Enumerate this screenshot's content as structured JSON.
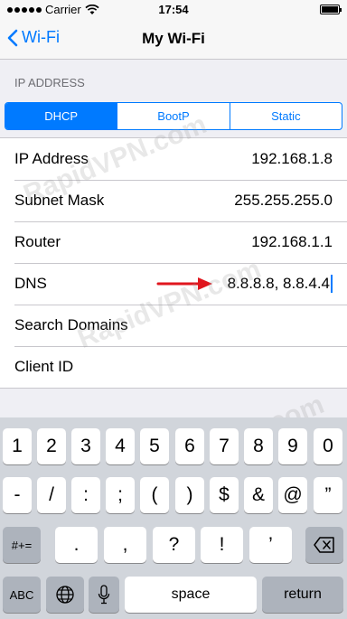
{
  "status_bar": {
    "carrier": "Carrier",
    "time": "17:54",
    "battery_level": 1.0
  },
  "nav": {
    "back_label": "Wi-Fi",
    "title": "My Wi-Fi"
  },
  "section_header": "IP ADDRESS",
  "segments": [
    {
      "label": "DHCP",
      "selected": true
    },
    {
      "label": "BootP",
      "selected": false
    },
    {
      "label": "Static",
      "selected": false
    }
  ],
  "rows": [
    {
      "label": "IP Address",
      "value": "192.168.1.8"
    },
    {
      "label": "Subnet Mask",
      "value": "255.255.255.0"
    },
    {
      "label": "Router",
      "value": "192.168.1.1"
    },
    {
      "label": "DNS",
      "value": "8.8.8.8, 8.8.4.4"
    },
    {
      "label": "Search Domains",
      "value": ""
    },
    {
      "label": "Client ID",
      "value": ""
    }
  ],
  "watermark": "RapidVPN.com",
  "keyboard": {
    "row1": [
      "1",
      "2",
      "3",
      "4",
      "5",
      "6",
      "7",
      "8",
      "9",
      "0"
    ],
    "row2": [
      "-",
      "/",
      ":",
      ";",
      "(",
      ")",
      "$",
      "&",
      "@",
      "”"
    ],
    "row3_mode": "#+=",
    "row3": [
      ".",
      ",",
      "?",
      "!",
      "’"
    ],
    "abc_label": "ABC",
    "space_label": "space",
    "return_label": "return"
  },
  "colors": {
    "accent": "#007aff",
    "arrow": "#e0161e",
    "background": "#efeff4"
  }
}
